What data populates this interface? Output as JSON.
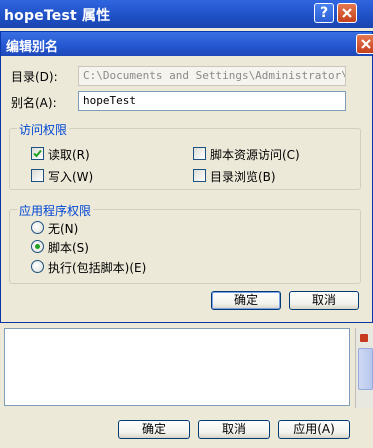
{
  "outer_window": {
    "title": "hopeTest 属性",
    "help_glyph": "?",
    "buttons": {
      "ok": "确定",
      "cancel": "取消",
      "apply": "应用(A)"
    }
  },
  "dialog": {
    "title": "编辑别名",
    "directory": {
      "label": "目录(D):",
      "value": "C:\\Documents and Settings\\Administrator\\My D"
    },
    "alias": {
      "label": "别名(A):",
      "value": "hopeTest"
    },
    "access": {
      "title": "访问权限",
      "read": {
        "label": "读取(R)",
        "checked": true
      },
      "write": {
        "label": "写入(W)",
        "checked": false
      },
      "script_source": {
        "label": "脚本资源访问(C)",
        "checked": false
      },
      "dir_browse": {
        "label": "目录浏览(B)",
        "checked": false
      }
    },
    "app_perm": {
      "title": "应用程序权限",
      "none": {
        "label": "无(N)",
        "selected": false
      },
      "scripts": {
        "label": "脚本(S)",
        "selected": true
      },
      "execute": {
        "label": "执行(包括脚本)(E)",
        "selected": false
      }
    },
    "buttons": {
      "ok": "确定",
      "cancel": "取消"
    }
  }
}
